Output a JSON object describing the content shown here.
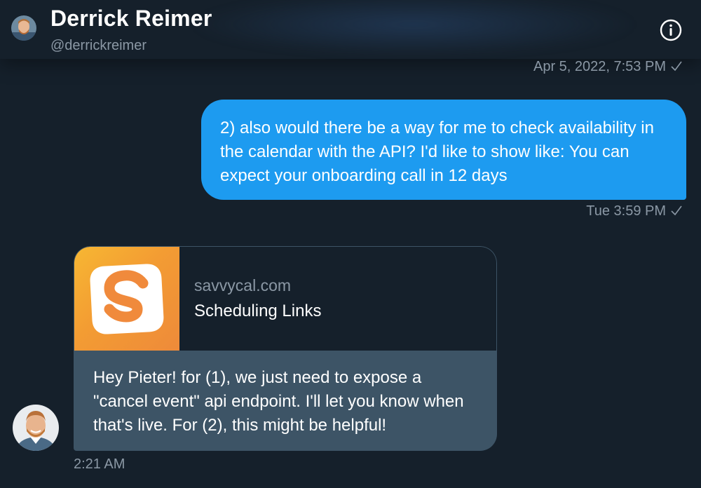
{
  "header": {
    "name": "Derrick Reimer",
    "handle": "@derrickreimer"
  },
  "messages": [
    {
      "direction": "sent",
      "timestamp_above": "Apr 5, 2022, 7:53 PM",
      "text": "2) also would there be a way for me to check availability in the calendar with the API? I'd like to show like: You can expect your onboarding call in 12 days",
      "timestamp_below": "Tue 3:59 PM"
    },
    {
      "direction": "received",
      "link_card": {
        "domain": "savvycal.com",
        "title": "Scheduling Links"
      },
      "text": "Hey Pieter! for (1), we just need to expose a \"cancel event\" api endpoint. I'll let you know when that's live. For (2), this might be helpful!",
      "timestamp": "2:21 AM"
    }
  ],
  "icons": {
    "info": "info-icon",
    "read_check": "checkmark-icon",
    "logo": "savvycal-logo-icon"
  },
  "colors": {
    "background": "#15202b",
    "sent_bubble": "#1d9bf0",
    "received_bubble": "#3d5466",
    "muted_text": "#8b98a5",
    "logo_orange": "#f39c33"
  }
}
